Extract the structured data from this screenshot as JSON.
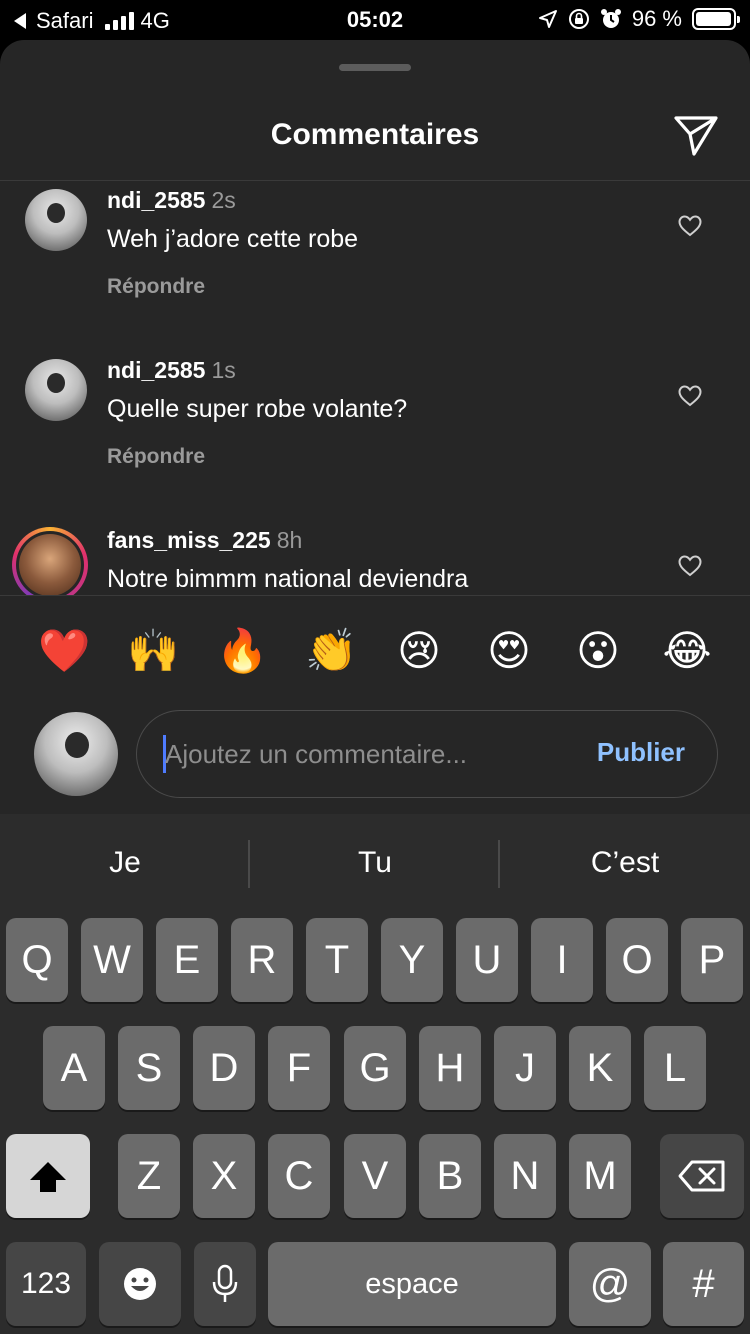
{
  "status_bar": {
    "back_app": "Safari",
    "network": "4G",
    "time": "05:02",
    "battery_text": "96 %",
    "battery_level": 0.96
  },
  "sheet": {
    "title": "Commentaires"
  },
  "comments": [
    {
      "username": "ndi_2585",
      "time": "2s",
      "text": "Weh j’adore cette robe",
      "reply": "Répondre"
    },
    {
      "username": "ndi_2585",
      "time": "1s",
      "text": "Quelle super robe volante?",
      "reply": "Répondre"
    },
    {
      "username": "fans_miss_225",
      "time": "8h",
      "text": "Notre bimmm national deviendra"
    }
  ],
  "quick_reactions": [
    "❤️",
    "🙌",
    "🔥",
    "👏",
    "😢",
    "😍",
    "😮",
    "😂"
  ],
  "composer": {
    "placeholder": "Ajoutez un commentaire...",
    "publish_label": "Publier"
  },
  "keyboard": {
    "suggestions": [
      "Je",
      "Tu",
      "C’est"
    ],
    "row1": [
      "Q",
      "W",
      "E",
      "R",
      "T",
      "Y",
      "U",
      "I",
      "O",
      "P"
    ],
    "row2": [
      "A",
      "S",
      "D",
      "F",
      "G",
      "H",
      "J",
      "K",
      "L"
    ],
    "row3": [
      "Z",
      "X",
      "C",
      "V",
      "B",
      "N",
      "M"
    ],
    "numbers_label": "123",
    "space_label": "espace",
    "at_label": "@",
    "hash_label": "#"
  }
}
